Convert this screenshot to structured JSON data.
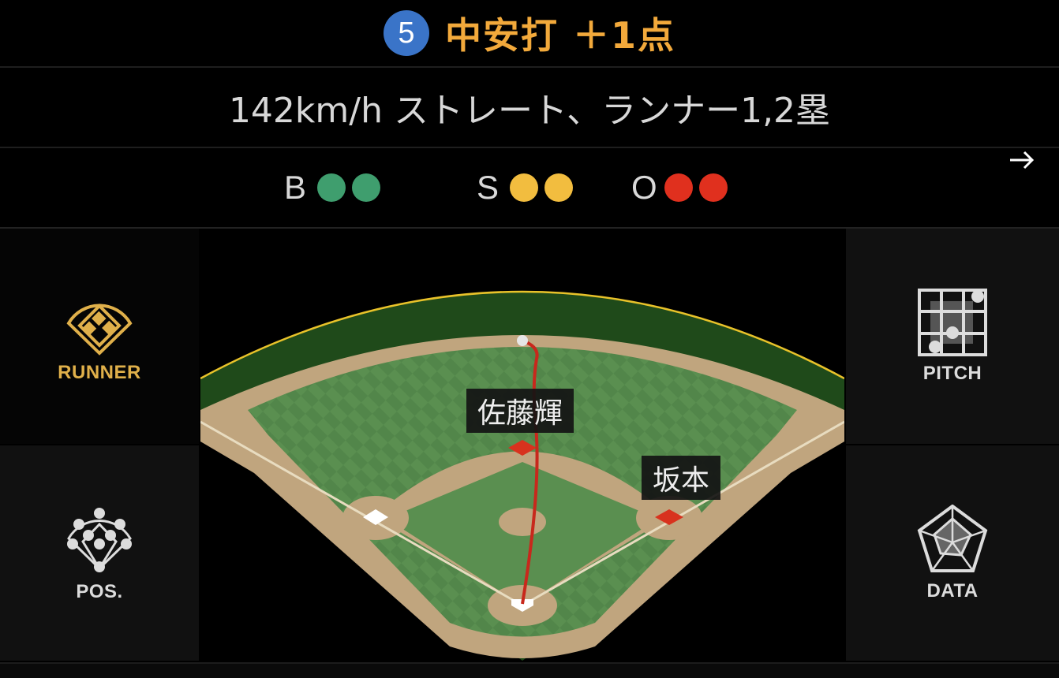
{
  "header": {
    "inning": "5",
    "result": "中安打 ＋1点"
  },
  "description": "142km/h ストレート、ランナー1,2塁",
  "count": {
    "balls": {
      "label": "B",
      "value": 2,
      "color": "#3f9e6e"
    },
    "strikes": {
      "label": "S",
      "value": 2,
      "color": "#f2bd3f"
    },
    "outs": {
      "label": "O",
      "value": 2,
      "color": "#e0301e"
    }
  },
  "nav": {
    "next_icon": "arrow-right-icon"
  },
  "side_buttons": {
    "runner": {
      "label": "RUNNER",
      "icon": "diamond-runner-icon",
      "active": true,
      "color": "#e0b04a"
    },
    "pos": {
      "label": "POS.",
      "icon": "field-positions-icon",
      "active": false,
      "color": "#dcdcdc"
    },
    "pitch": {
      "label": "PITCH",
      "icon": "strike-zone-grid-icon",
      "active": false,
      "color": "#dcdcdc"
    },
    "data": {
      "label": "DATA",
      "icon": "radar-chart-icon",
      "active": false,
      "color": "#dcdcdc"
    }
  },
  "field": {
    "runners": [
      {
        "name": "佐藤輝",
        "base": "second"
      },
      {
        "name": "坂本",
        "base": "first"
      }
    ],
    "occupied_bases": [
      "first",
      "second"
    ],
    "hit_direction": "center",
    "colors": {
      "grass": "#5a8f50",
      "dirt": "#c0a57e",
      "wall": "#1f4a1a",
      "warning_line": "#e8c22a",
      "trajectory": "#c8281c",
      "occupied_base": "#d8321e"
    }
  }
}
